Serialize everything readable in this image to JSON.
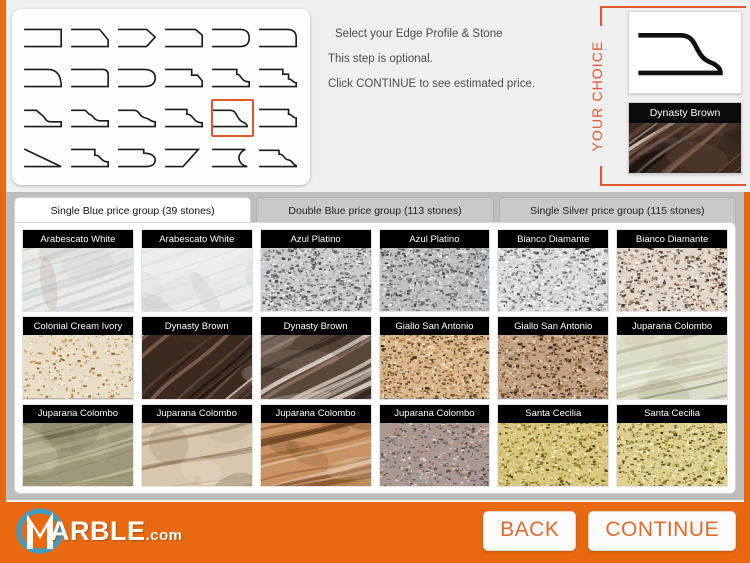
{
  "instructions": {
    "line1": "Select your Edge Profile & Stone",
    "line2": "This step is optional.",
    "line3": "Click CONTINUE to see estimated price."
  },
  "colors": {
    "brand_orange": "#e8690f",
    "accent_orange": "#e2572a",
    "selection_border": "#e2572a",
    "button_text": "#e06a2b",
    "panel_grey": "#efefef",
    "board_grey": "#bdbdbd"
  },
  "edge_profiles": {
    "selected_index": 16,
    "items": [
      {
        "id": "square",
        "label": "Square"
      },
      {
        "id": "bevel",
        "label": "Bevel"
      },
      {
        "id": "double-bevel",
        "label": "Double Bevel"
      },
      {
        "id": "small-bevel",
        "label": "Small Bevel"
      },
      {
        "id": "half-bullnose",
        "label": "Half Bullnose"
      },
      {
        "id": "quarter-round",
        "label": "Quarter Round"
      },
      {
        "id": "cove",
        "label": "Cove"
      },
      {
        "id": "eased",
        "label": "Eased"
      },
      {
        "id": "full-bullnose",
        "label": "Full Bullnose"
      },
      {
        "id": "step-bevel",
        "label": "Step Bevel"
      },
      {
        "id": "ogee-step",
        "label": "Ogee Step"
      },
      {
        "id": "double-step",
        "label": "Double Step"
      },
      {
        "id": "stair-ogee",
        "label": "Stair Ogee"
      },
      {
        "id": "triple-step",
        "label": "Triple Step"
      },
      {
        "id": "waterfall",
        "label": "Waterfall"
      },
      {
        "id": "step-round",
        "label": "Step Round"
      },
      {
        "id": "ogee-large",
        "label": "Large Ogee"
      },
      {
        "id": "notch-step",
        "label": "Notch Step"
      },
      {
        "id": "long-bevel",
        "label": "Long Bevel"
      },
      {
        "id": "dupont",
        "label": "Dupont"
      },
      {
        "id": "step-bullnose",
        "label": "Step Bullnose"
      },
      {
        "id": "chisel",
        "label": "Chisel"
      },
      {
        "id": "cove-dupont",
        "label": "Cove Dupont"
      },
      {
        "id": "double-ogee",
        "label": "Double Ogee"
      }
    ]
  },
  "your_choice": {
    "title": "YOUR CHOICE",
    "edge_profile_id": "ogee-large",
    "stone_name": "Dynasty Brown"
  },
  "tabs": [
    {
      "label": "Single Blue price group (39 stones)",
      "active": true
    },
    {
      "label": "Double Blue price group (113 stones)",
      "active": false
    },
    {
      "label": "Single Silver price group (115 stones)",
      "active": false
    }
  ],
  "stones": [
    {
      "name": "Arabescato White",
      "texture": "marble-white-veined"
    },
    {
      "name": "Arabescato White",
      "texture": "marble-white-veined-2"
    },
    {
      "name": "Azul Platino",
      "texture": "granite-grey-speckle"
    },
    {
      "name": "Azul Platino",
      "texture": "granite-grey-speckle-2"
    },
    {
      "name": "Bianco Diamante",
      "texture": "granite-light-speckle"
    },
    {
      "name": "Bianco Diamante",
      "texture": "granite-brown-speckle"
    },
    {
      "name": "Colonial Cream Ivory",
      "texture": "granite-cream-gold"
    },
    {
      "name": "Dynasty Brown",
      "texture": "marble-dark-brown"
    },
    {
      "name": "Dynasty Brown",
      "texture": "marble-brown-veined"
    },
    {
      "name": "Giallo San Antonio",
      "texture": "granite-tan-speckle"
    },
    {
      "name": "Giallo San Antonio",
      "texture": "granite-tan-dark-speckle"
    },
    {
      "name": "Juparana Colombo",
      "texture": "granite-pale-sage"
    },
    {
      "name": "Juparana Colombo",
      "texture": "granite-olive-flow"
    },
    {
      "name": "Juparana Colombo",
      "texture": "granite-beige-flow"
    },
    {
      "name": "Juparana Colombo",
      "texture": "granite-orange-flow"
    },
    {
      "name": "Juparana Colombo",
      "texture": "granite-grey-pink"
    },
    {
      "name": "Santa Cecilia",
      "texture": "granite-yellow-gold"
    },
    {
      "name": "Santa Cecilia",
      "texture": "granite-yellow-speckle"
    }
  ],
  "footer": {
    "logo_text": "ARBLE",
    "logo_suffix": ".com",
    "back_label": "BACK",
    "continue_label": "CONTINUE"
  }
}
